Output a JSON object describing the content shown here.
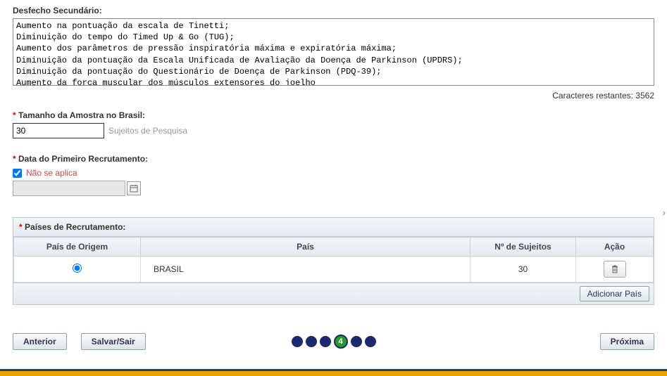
{
  "desfecho": {
    "label": "Desfecho Secundário:",
    "text": "Aumento na pontuação da escala de Tinetti;\nDiminuição do tempo do Timed Up & Go (TUG);\nAumento dos parâmetros de pressão inspiratória máxima e expiratória máxima;\nDiminuição da pontuação da Escala Unificada de Avaliação da Doença de Parkinson (UPDRS);\nDiminuição da pontuação do Questionário de Doença de Parkinson (PDQ-39);\nAumento da força muscular dos músculos extensores do joelho",
    "char_count_label": "Caracteres restantes: ",
    "char_count_value": "3562"
  },
  "amostra": {
    "label": "Tamanho da Amostra no Brasil:",
    "value": "30",
    "hint": "Sujeitos de Pesquisa"
  },
  "data_recrutamento": {
    "label": "Data do Primeiro Recrutamento:",
    "nao_aplica_label": "Não se aplica",
    "checked": true
  },
  "paises": {
    "panel_title": "Países de Recrutamento:",
    "headers": {
      "origem": "País de Origem",
      "pais": "País",
      "sujeitos": "Nº de Sujeitos",
      "acao": "Ação"
    },
    "rows": [
      {
        "origem_selected": true,
        "pais": "BRASIL",
        "sujeitos": "30"
      }
    ],
    "add_button": "Adicionar País"
  },
  "nav": {
    "anterior": "Anterior",
    "salvar": "Salvar/Sair",
    "proxima": "Próxima",
    "current_step": "4"
  }
}
